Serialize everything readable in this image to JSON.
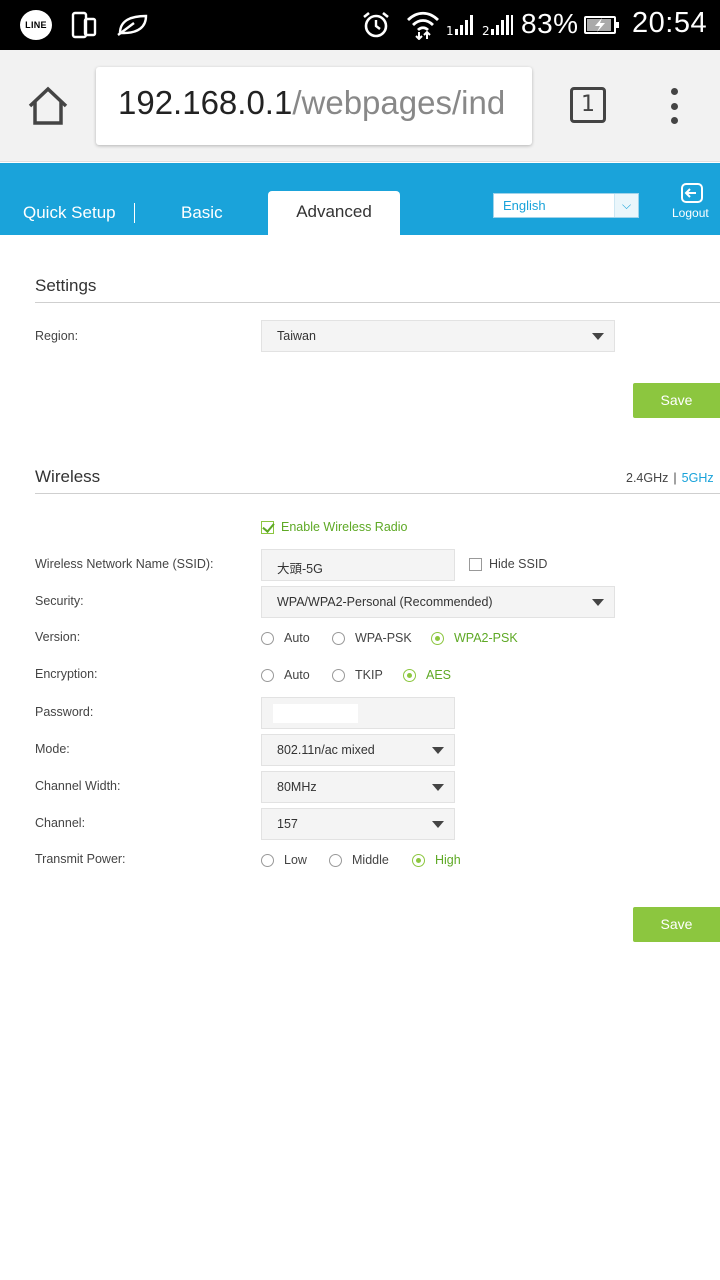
{
  "status_bar": {
    "app_icons": [
      "line-app-icon",
      "dual-screen-icon",
      "leaf-icon"
    ],
    "line_label": "LINE",
    "battery_percent": "83%",
    "time": "20:54",
    "indicators": [
      "alarm-icon",
      "wifi-icon",
      "signal-icon",
      "signal-2-icon",
      "battery-charging-icon"
    ]
  },
  "browser": {
    "url_host": "192.168.0.1",
    "url_path": "/webpages/ind",
    "tab_count": "1"
  },
  "nav": {
    "tabs": [
      {
        "label": "Quick Setup",
        "active": false
      },
      {
        "label": "Basic",
        "active": false
      },
      {
        "label": "Advanced",
        "active": true
      }
    ],
    "language": "English",
    "logout_label": "Logout",
    "accent_color": "#1aa3da"
  },
  "settings": {
    "title": "Settings",
    "region_label": "Region:",
    "region_value": "Taiwan",
    "save_label": "Save"
  },
  "wireless": {
    "title": "Wireless",
    "band_24": "2.4GHz",
    "band_sep": "|",
    "band_5": "5GHz",
    "enable_label": "Enable Wireless Radio",
    "enable_checked": true,
    "ssid_label": "Wireless Network Name (SSID):",
    "ssid_value": "大頭-5G",
    "hide_ssid_label": "Hide SSID",
    "hide_ssid_checked": false,
    "security_label": "Security:",
    "security_value": "WPA/WPA2-Personal (Recommended)",
    "version_label": "Version:",
    "version_options": [
      "Auto",
      "WPA-PSK",
      "WPA2-PSK"
    ],
    "version_selected": "WPA2-PSK",
    "encryption_label": "Encryption:",
    "encryption_options": [
      "Auto",
      "TKIP",
      "AES"
    ],
    "encryption_selected": "AES",
    "password_label": "Password:",
    "mode_label": "Mode:",
    "mode_value": "802.11n/ac mixed",
    "channel_width_label": "Channel Width:",
    "channel_width_value": "80MHz",
    "channel_label": "Channel:",
    "channel_value": "157",
    "power_label": "Transmit Power:",
    "power_options": [
      "Low",
      "Middle",
      "High"
    ],
    "power_selected": "High",
    "save_label": "Save",
    "active_color": "#8cc63f"
  }
}
